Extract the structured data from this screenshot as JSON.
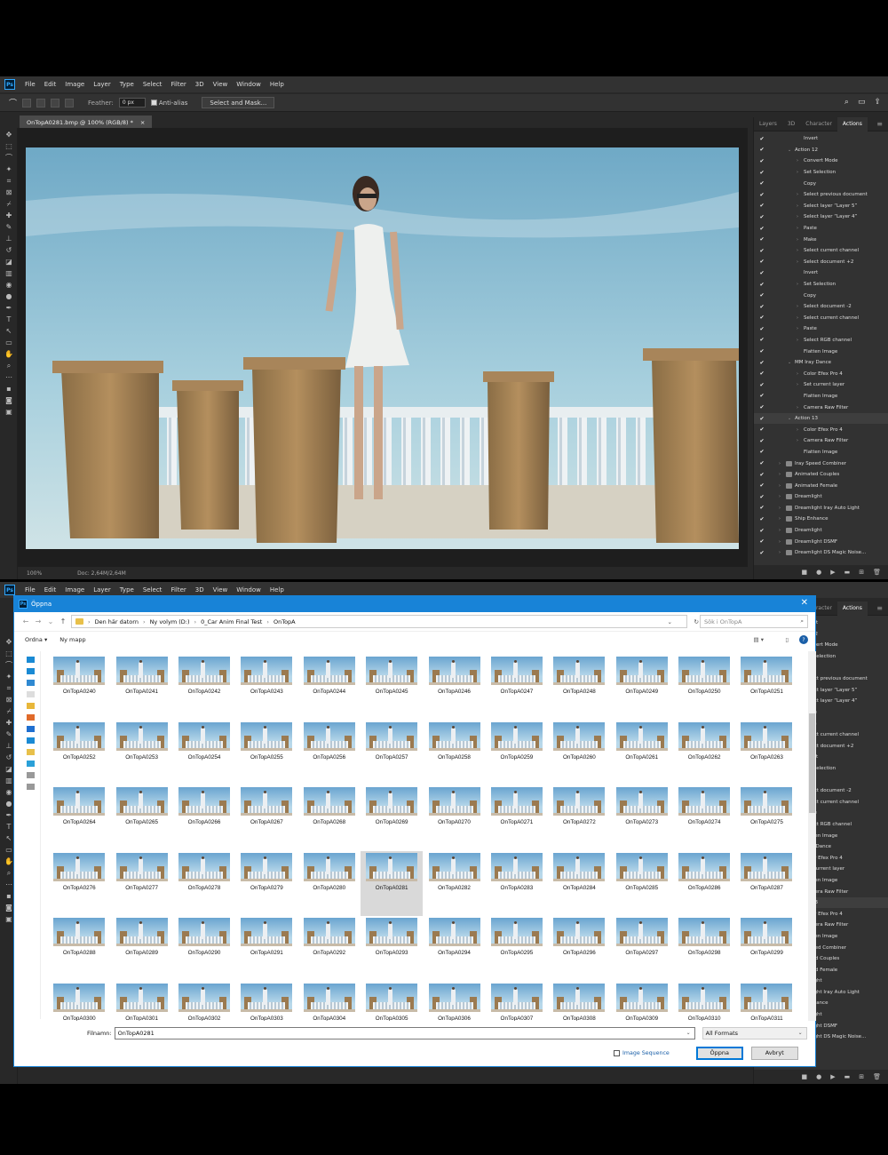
{
  "app": {
    "menu": [
      "File",
      "Edit",
      "Image",
      "Layer",
      "Type",
      "Select",
      "Filter",
      "3D",
      "View",
      "Window",
      "Help"
    ],
    "logo": "Ps"
  },
  "options": {
    "feather_label": "Feather:",
    "feather_value": "0 px",
    "antialias_label": "Anti-alias",
    "select_mask_label": "Select and Mask..."
  },
  "document": {
    "tab_title": "OnTopA0281.bmp @ 100% (RGB/8) *",
    "zoom": "100%",
    "doc_info": "Doc: 2,64M/2,64M"
  },
  "panel": {
    "tabs": [
      "Layers",
      "3D",
      "Character",
      "Actions"
    ],
    "active_tab": "Actions",
    "actions": [
      {
        "label": "Invert",
        "level": 2
      },
      {
        "label": "Action 12",
        "level": 1,
        "open": true
      },
      {
        "label": "Convert Mode",
        "level": 2,
        "arrow": true
      },
      {
        "label": "Set Selection",
        "level": 2,
        "arrow": true
      },
      {
        "label": "Copy",
        "level": 2
      },
      {
        "label": "Select previous document",
        "level": 2,
        "arrow": true
      },
      {
        "label": "Select layer “Layer 5”",
        "level": 2,
        "arrow": true
      },
      {
        "label": "Select layer “Layer 4”",
        "level": 2,
        "arrow": true
      },
      {
        "label": "Paste",
        "level": 2,
        "arrow": true
      },
      {
        "label": "Make",
        "level": 2,
        "arrow": true
      },
      {
        "label": "Select current channel",
        "level": 2,
        "arrow": true
      },
      {
        "label": "Select document +2",
        "level": 2,
        "arrow": true
      },
      {
        "label": "Invert",
        "level": 2
      },
      {
        "label": "Set Selection",
        "level": 2,
        "arrow": true
      },
      {
        "label": "Copy",
        "level": 2
      },
      {
        "label": "Select document -2",
        "level": 2,
        "arrow": true
      },
      {
        "label": "Select current channel",
        "level": 2,
        "arrow": true
      },
      {
        "label": "Paste",
        "level": 2,
        "arrow": true
      },
      {
        "label": "Select RGB channel",
        "level": 2,
        "arrow": true
      },
      {
        "label": "Flatten Image",
        "level": 2
      },
      {
        "label": "MM Iray Dance",
        "level": 1,
        "open": true
      },
      {
        "label": "Color Efex Pro 4",
        "level": 2,
        "arrow": true
      },
      {
        "label": "Set current layer",
        "level": 2,
        "arrow": true
      },
      {
        "label": "Flatten Image",
        "level": 2
      },
      {
        "label": "Camera Raw Filter",
        "level": 2,
        "arrow": true
      },
      {
        "label": "Action 13",
        "level": 1,
        "open": true,
        "selected": true
      },
      {
        "label": "Color Efex Pro 4",
        "level": 2,
        "arrow": true
      },
      {
        "label": "Camera Raw Filter",
        "level": 2,
        "arrow": true
      },
      {
        "label": "Flatten Image",
        "level": 2
      },
      {
        "label": "Iray Speed Combiner",
        "level": 0,
        "folder": true
      },
      {
        "label": "Animated Couples",
        "level": 0,
        "folder": true
      },
      {
        "label": "Animated Female",
        "level": 0,
        "folder": true
      },
      {
        "label": "Dreamlight",
        "level": 0,
        "folder": true
      },
      {
        "label": "Dreamlight Iray Auto Light",
        "level": 0,
        "folder": true
      },
      {
        "label": "Ship Enhance",
        "level": 0,
        "folder": true
      },
      {
        "label": "Dreamlight",
        "level": 0,
        "folder": true
      },
      {
        "label": "Dreamlight DSMF",
        "level": 0,
        "folder": true
      },
      {
        "label": "Dreamlight DS Magic Noise...",
        "level": 0,
        "folder": true
      }
    ]
  },
  "dialog": {
    "title": "Öppna",
    "breadcrumb": [
      "Den här datorn",
      "Ny volym (D:)",
      "0_Car Anim Final Test",
      "OnTopA"
    ],
    "search_placeholder": "Sök i OnTopA",
    "organize_label": "Ordna",
    "new_folder_label": "Ny mapp",
    "files": [
      "OnTopA0240",
      "OnTopA0241",
      "OnTopA0242",
      "OnTopA0243",
      "OnTopA0244",
      "OnTopA0245",
      "OnTopA0246",
      "OnTopA0247",
      "OnTopA0248",
      "OnTopA0249",
      "OnTopA0250",
      "OnTopA0251",
      "OnTopA0252",
      "OnTopA0253",
      "OnTopA0254",
      "OnTopA0255",
      "OnTopA0256",
      "OnTopA0257",
      "OnTopA0258",
      "OnTopA0259",
      "OnTopA0260",
      "OnTopA0261",
      "OnTopA0262",
      "OnTopA0263",
      "OnTopA0264",
      "OnTopA0265",
      "OnTopA0266",
      "OnTopA0267",
      "OnTopA0268",
      "OnTopA0269",
      "OnTopA0270",
      "OnTopA0271",
      "OnTopA0272",
      "OnTopA0273",
      "OnTopA0274",
      "OnTopA0275",
      "OnTopA0276",
      "OnTopA0277",
      "OnTopA0278",
      "OnTopA0279",
      "OnTopA0280",
      "OnTopA0281",
      "OnTopA0282",
      "OnTopA0283",
      "OnTopA0284",
      "OnTopA0285",
      "OnTopA0286",
      "OnTopA0287",
      "OnTopA0288",
      "OnTopA0289",
      "OnTopA0290",
      "OnTopA0291",
      "OnTopA0292",
      "OnTopA0293",
      "OnTopA0294",
      "OnTopA0295",
      "OnTopA0296",
      "OnTopA0297",
      "OnTopA0298",
      "OnTopA0299",
      "OnTopA0300",
      "OnTopA0301",
      "OnTopA0302",
      "OnTopA0303",
      "OnTopA0304",
      "OnTopA0305",
      "OnTopA0306",
      "OnTopA0307",
      "OnTopA0308",
      "OnTopA0309",
      "OnTopA0310",
      "OnTopA0311"
    ],
    "selected_file": "OnTopA0281",
    "filename_label": "Filnamn:",
    "filename_value": "OnTopA0281",
    "format_value": "All Formats",
    "image_sequence_label": "Image Sequence",
    "open_label": "Öppna",
    "cancel_label": "Avbryt"
  }
}
